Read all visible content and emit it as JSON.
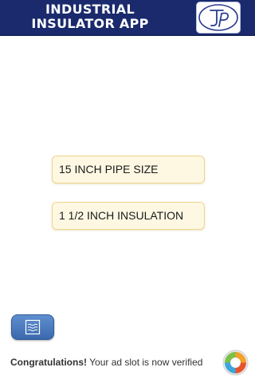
{
  "header": {
    "title_line1": "INDUSTRIAL",
    "title_line2": "INSULATOR APP",
    "logo_icon": "jp-monogram-logo"
  },
  "fields": {
    "pipe_size": "15 INCH PIPE SIZE",
    "insulation": "1 1/2 INCH INSULATION"
  },
  "menu_button": {
    "icon": "notes-icon"
  },
  "ad": {
    "headline": "Congratulations!",
    "message": " Your ad slot is now verified",
    "logo_icon": "ad-network-logo"
  },
  "colors": {
    "header_bg": "#1a2a6c",
    "field_bg": "#fef8e3",
    "field_border": "#efd58c",
    "button_blue": "#3a68ad"
  }
}
